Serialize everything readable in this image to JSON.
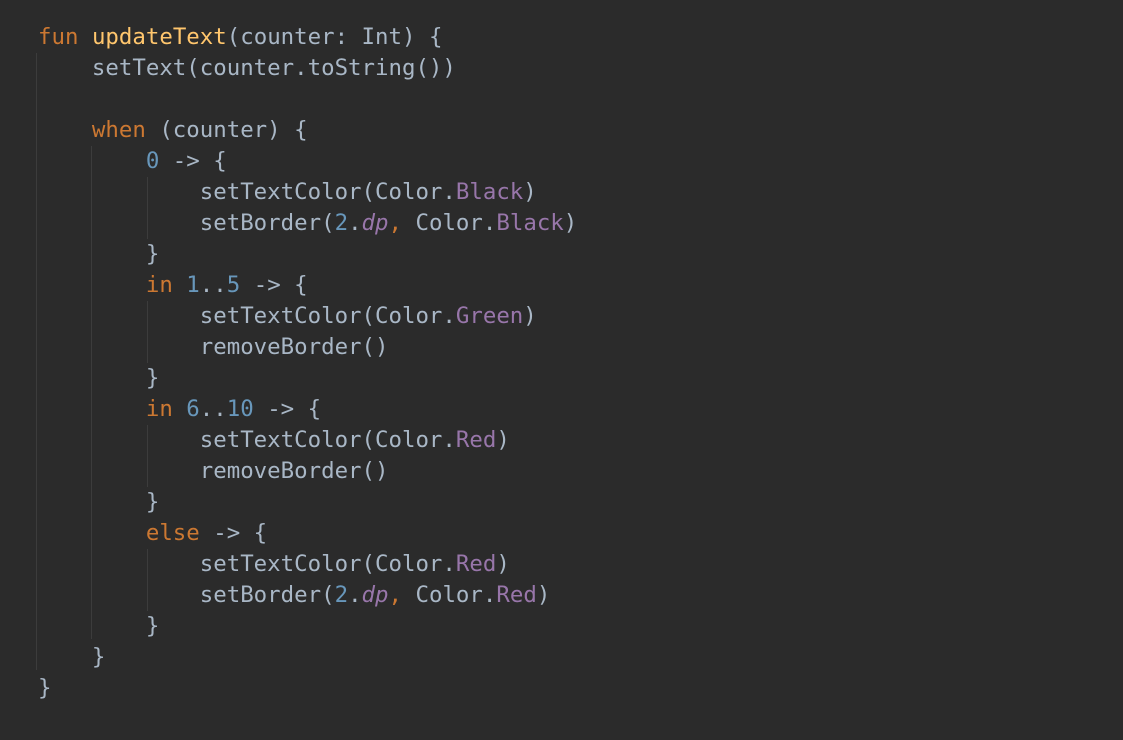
{
  "colors": {
    "background": "#2b2b2b",
    "keyword": "#cc7832",
    "function_declaration": "#ffc66d",
    "default_text": "#a9b7c6",
    "number": "#6897bb",
    "enum_constant": "#9876aa",
    "extension_property": "#9876aa",
    "indent_guide": "#3c3c3c"
  },
  "lines": [
    [
      {
        "t": "fun",
        "c": "kw"
      },
      {
        "t": " "
      },
      {
        "t": "updateText",
        "c": "fn"
      },
      {
        "t": "(counter: Int) {"
      }
    ],
    [
      {
        "t": "    setText(counter.toString())"
      }
    ],
    [],
    [
      {
        "t": "    "
      },
      {
        "t": "when",
        "c": "kw"
      },
      {
        "t": " (counter) {"
      }
    ],
    [
      {
        "t": "        "
      },
      {
        "t": "0",
        "c": "num"
      },
      {
        "t": " -> {"
      }
    ],
    [
      {
        "t": "            setTextColor(Color."
      },
      {
        "t": "Black",
        "c": "enum"
      },
      {
        "t": ")"
      }
    ],
    [
      {
        "t": "            setBorder("
      },
      {
        "t": "2",
        "c": "num"
      },
      {
        "t": "."
      },
      {
        "t": "dp",
        "c": "ext"
      },
      {
        "t": ", ",
        "c": "kw"
      },
      {
        "t": "Color."
      },
      {
        "t": "Black",
        "c": "enum"
      },
      {
        "t": ")"
      }
    ],
    [
      {
        "t": "        }"
      }
    ],
    [
      {
        "t": "        "
      },
      {
        "t": "in",
        "c": "kw"
      },
      {
        "t": " "
      },
      {
        "t": "1",
        "c": "num"
      },
      {
        "t": ".."
      },
      {
        "t": "5",
        "c": "num"
      },
      {
        "t": " -> {"
      }
    ],
    [
      {
        "t": "            setTextColor(Color."
      },
      {
        "t": "Green",
        "c": "enum"
      },
      {
        "t": ")"
      }
    ],
    [
      {
        "t": "            removeBorder()"
      }
    ],
    [
      {
        "t": "        }"
      }
    ],
    [
      {
        "t": "        "
      },
      {
        "t": "in",
        "c": "kw"
      },
      {
        "t": " "
      },
      {
        "t": "6",
        "c": "num"
      },
      {
        "t": ".."
      },
      {
        "t": "10",
        "c": "num"
      },
      {
        "t": " -> {"
      }
    ],
    [
      {
        "t": "            setTextColor(Color."
      },
      {
        "t": "Red",
        "c": "enum"
      },
      {
        "t": ")"
      }
    ],
    [
      {
        "t": "            removeBorder()"
      }
    ],
    [
      {
        "t": "        }"
      }
    ],
    [
      {
        "t": "        "
      },
      {
        "t": "else",
        "c": "kw"
      },
      {
        "t": " -> {"
      }
    ],
    [
      {
        "t": "            setTextColor(Color."
      },
      {
        "t": "Red",
        "c": "enum"
      },
      {
        "t": ")"
      }
    ],
    [
      {
        "t": "            setBorder("
      },
      {
        "t": "2",
        "c": "num"
      },
      {
        "t": "."
      },
      {
        "t": "dp",
        "c": "ext"
      },
      {
        "t": ", ",
        "c": "kw"
      },
      {
        "t": "Color."
      },
      {
        "t": "Red",
        "c": "enum"
      },
      {
        "t": ")"
      }
    ],
    [
      {
        "t": "        }"
      }
    ],
    [
      {
        "t": "    }"
      }
    ],
    [
      {
        "t": "}"
      }
    ]
  ]
}
